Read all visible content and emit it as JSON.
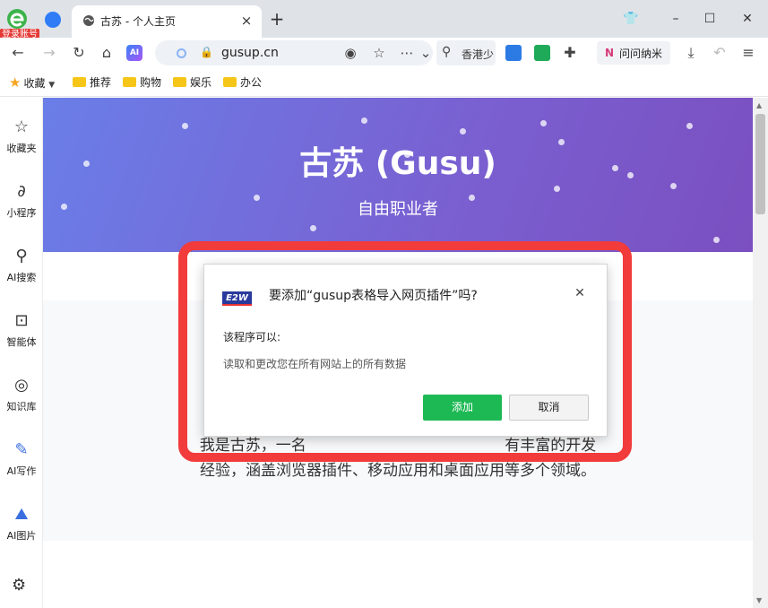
{
  "app": {
    "login_badge": "登录账号",
    "tab": {
      "title": "古苏 - 个人主页",
      "close": "×"
    },
    "new_tab": "+"
  },
  "window_controls": {
    "shirt": "👕",
    "minimize": "–",
    "maximize": "☐",
    "close": "✕"
  },
  "toolbar": {
    "back": "←",
    "forward": "→",
    "reload": "↻",
    "home": "⌂",
    "ai_label": "AI",
    "address": {
      "url": "gusup.cn",
      "lock": "🔒"
    },
    "add_bookmark": "☆",
    "more": "⋯",
    "dropdown": "⌄",
    "search": {
      "icon": "⚲",
      "text": "香港少"
    },
    "wenwen": {
      "logo": "N",
      "label": "问问纳米"
    },
    "download": "⤓",
    "undo": "↶",
    "menu": "≡"
  },
  "bookmarks": {
    "favorites_label": "收藏",
    "folders": [
      "推荐",
      "购物",
      "娱乐",
      "办公"
    ]
  },
  "sidebar": {
    "items": [
      {
        "icon": "☆",
        "label": "收藏夹"
      },
      {
        "icon": "∂",
        "label": "小程序"
      },
      {
        "icon": "⚲",
        "label": "AI搜索"
      },
      {
        "icon": "⊡",
        "label": "智能体"
      },
      {
        "icon": "◎",
        "label": "知识库"
      },
      {
        "icon": "✎",
        "label": "AI写作"
      },
      {
        "icon": "⛰",
        "label": "AI图片"
      }
    ],
    "settings_icon": "⚙"
  },
  "page": {
    "hero_title": "古苏 (Gusu)",
    "hero_subtitle": "自由职业者",
    "intro": "我是古苏，一名…经验，涵盖浏览器插件、移动应用和桌面应用等多个领域。"
  },
  "intro_lines": [
    "我是古苏，一名                                         有丰富的开发",
    "经验，涵盖浏览器插件、移动应用和桌面应用等多个领域。"
  ],
  "dialog": {
    "logo_text": "E2W",
    "title": "要添加“gusup表格导入网页插件”吗?",
    "close": "✕",
    "permission_heading": "该程序可以:",
    "permission_item": "读取和更改您在所有网站上的所有数据",
    "add_button": "添加",
    "cancel_button": "取消"
  },
  "colors": {
    "hero_start": "#6a7ee8",
    "hero_end": "#7b4fc0",
    "highlight": "#f23b3b",
    "add_button": "#1db954"
  }
}
